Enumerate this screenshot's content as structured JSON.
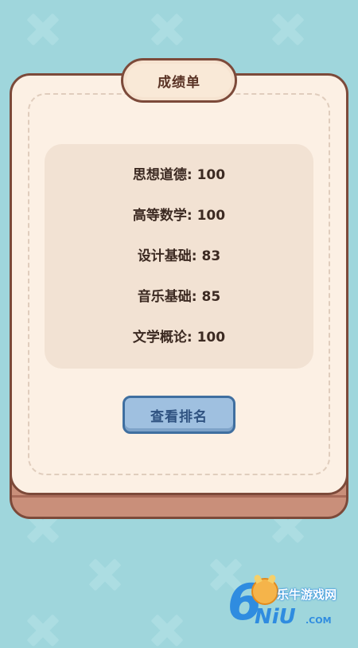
{
  "report": {
    "title": "成绩单",
    "grades": [
      {
        "text": "思想道德: 100",
        "subject": "思想道德",
        "score": 100
      },
      {
        "text": "高等数学: 100",
        "subject": "高等数学",
        "score": 100
      },
      {
        "text": "设计基础: 83",
        "subject": "设计基础",
        "score": 83
      },
      {
        "text": "音乐基础: 85",
        "subject": "音乐基础",
        "score": 85
      },
      {
        "text": "文学概论: 100",
        "subject": "文学概论",
        "score": 100
      }
    ],
    "rank_button_label": "查看排名"
  },
  "watermark": {
    "brand": "6",
    "name": "乐牛游戏网",
    "domain": "NiU",
    "suffix": ".COM"
  },
  "colors": {
    "background": "#9fd6dc",
    "card": "#fcf0e4",
    "card_border": "#7c4a3a",
    "panel": "#f2e2d3",
    "button": "#9fc0e0",
    "button_border": "#3f6fa0",
    "text": "#3c2a22"
  }
}
